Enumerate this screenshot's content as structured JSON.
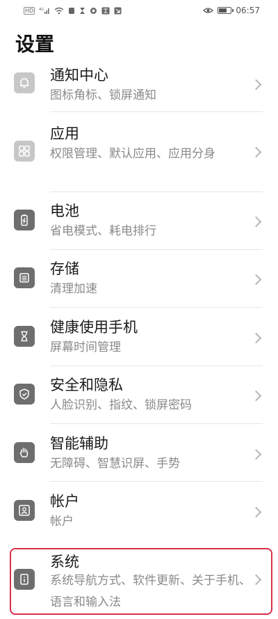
{
  "status_bar": {
    "left_icons": [
      "hd-icon",
      "signal-icon",
      "wifi-icon",
      "nfc-icon",
      "hourglass-icon",
      "sync-icon",
      "translate-icon",
      "download-icon"
    ],
    "hd_label": "HD",
    "network_label": "4G",
    "time": "06:57",
    "battery_level": 0.75
  },
  "header": {
    "title": "设置"
  },
  "items": [
    {
      "title": "通知中心",
      "subtitle": "图标角标、锁屏通知",
      "icon": "bell-icon"
    },
    {
      "title": "应用",
      "subtitle": "权限管理、默认应用、应用分身",
      "icon": "apps-grid-icon"
    },
    {
      "title": "电池",
      "subtitle": "省电模式、耗电排行",
      "icon": "battery-icon"
    },
    {
      "title": "存储",
      "subtitle": "清理加速",
      "icon": "storage-icon"
    },
    {
      "title": "健康使用手机",
      "subtitle": "屏幕时间管理",
      "icon": "hourglass-icon"
    },
    {
      "title": "安全和隐私",
      "subtitle": "人脸识别、指纹、锁屏密码",
      "icon": "shield-icon"
    },
    {
      "title": "智能辅助",
      "subtitle": "无障碍、智慧识屏、手势",
      "icon": "hand-icon"
    },
    {
      "title": "帐户",
      "subtitle": "帐户",
      "icon": "account-icon"
    },
    {
      "title": "系统",
      "subtitle": "系统导航方式、软件更新、关于手机、语言和输入法",
      "icon": "info-icon"
    }
  ],
  "colors": {
    "highlight": "#d9304b",
    "icon_bg": "#6e6e6e",
    "subtitle": "#8a8a8a"
  }
}
